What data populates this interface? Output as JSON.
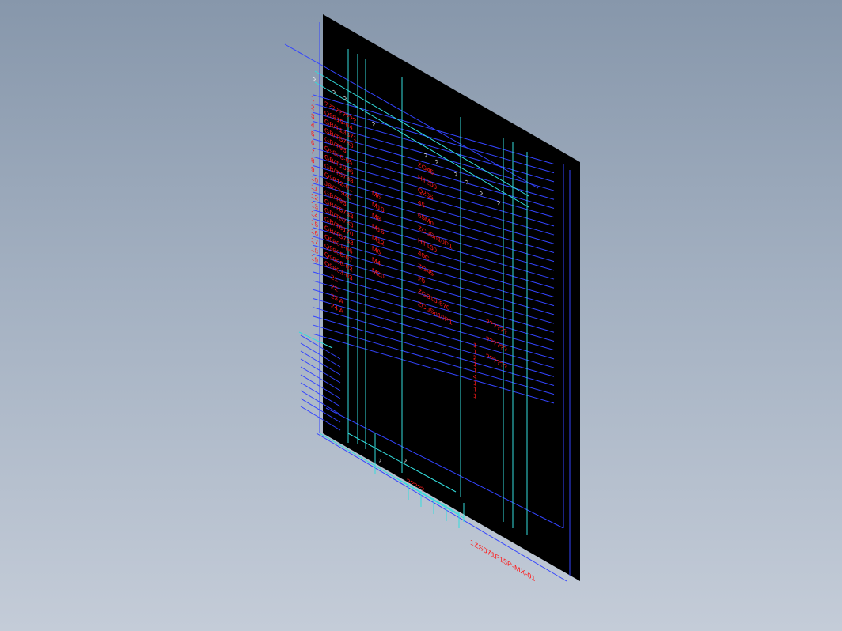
{
  "viewport": {
    "background_top": "#8797ab",
    "background_bottom": "#c4ccd8",
    "sheet_color": "#000000",
    "frame_line_color": "#3344ff",
    "grid_line_color": "#33dddd",
    "text_color": "#ff1a1a"
  },
  "row_numbers": [
    "1",
    "2",
    "3",
    "4",
    "5",
    "6",
    "7",
    "8",
    "9",
    "10",
    "11",
    "12",
    "13",
    "14",
    "15",
    "16",
    "17",
    "18",
    "19"
  ],
  "row_codes": [
    "?????????",
    "Q9819-04",
    "GB/T13871",
    "GB/T5783",
    "GB/T93",
    "Q9806-05",
    "GB/T1096",
    "GB/T5783",
    "Q9812-01",
    "JB/T7940",
    "GB/T93",
    "GB/T5783",
    "GB/T5783",
    "GB/T6170",
    "GB/T5783",
    "Q9801-06",
    "Q9805-07",
    "Q9808-02",
    "Q9803-03"
  ],
  "row_specs": [
    "M6",
    "M10",
    "M8",
    "M16",
    "M12",
    "M6",
    "M4",
    "M20"
  ],
  "lower_codes": [
    "21",
    "22",
    "23 A",
    "24 A"
  ],
  "material_labels": [
    "ZG45",
    "HT200",
    "Q235",
    "45",
    "65Mn",
    "ZCuSn10P1",
    "HT150",
    "40Cr",
    "ZG45",
    "20",
    "ZG310-570",
    "ZCuSn10P1"
  ],
  "weight_labels": [
    "1",
    "1",
    "2",
    "1",
    "1",
    "4",
    "1",
    "1",
    "1"
  ],
  "note_labels": [
    "??????",
    "??????",
    "??????"
  ],
  "marks": [
    "?",
    "?",
    "?",
    "?",
    "?",
    "?",
    "?",
    "?",
    "?",
    "?",
    "?",
    "?"
  ],
  "title_number": "1ZS071F15P-MX-01",
  "title_small": "?????"
}
